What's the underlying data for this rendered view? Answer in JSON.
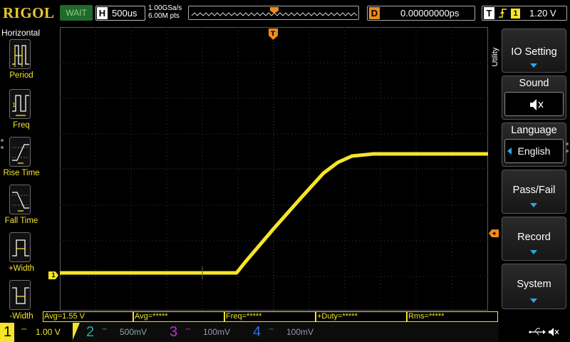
{
  "header": {
    "logo": "RIGOL",
    "run_status": "WAIT",
    "horizontal_letter": "H",
    "timebase": "500us",
    "sample_rate": "1.00GSa/s",
    "memory_depth": "6.00M pts",
    "delay_letter": "D",
    "delay_value": "0.00000000ps",
    "trigger_letter": "T",
    "trigger_edge": "rising-edge-icon",
    "trigger_source": "1",
    "trigger_level": "1.20 V"
  },
  "left_panel": {
    "title": "Horizontal",
    "items": [
      {
        "label": "Period",
        "icon": "period-icon"
      },
      {
        "label": "Freq",
        "icon": "freq-icon"
      },
      {
        "label": "Rise Time",
        "icon": "rise-time-icon"
      },
      {
        "label": "Fall Time",
        "icon": "fall-time-icon"
      },
      {
        "label": "+Width",
        "icon": "positive-width-icon"
      },
      {
        "label": "-Width",
        "icon": "negative-width-icon"
      }
    ]
  },
  "right_menu": {
    "tab": "Utility",
    "items": [
      {
        "label": "IO Setting",
        "kind": "submenu"
      },
      {
        "label": "Sound",
        "value_icon": "speaker-muted-icon"
      },
      {
        "label": "Language",
        "value": "English"
      },
      {
        "label": "Pass/Fail",
        "kind": "submenu"
      },
      {
        "label": "Record",
        "kind": "submenu"
      },
      {
        "label": "System",
        "kind": "submenu"
      }
    ]
  },
  "markers": {
    "channel1": "1",
    "trigger_position": "T"
  },
  "measurements": [
    {
      "text": "Avg=1.55 V"
    },
    {
      "text": "Avg=*****"
    },
    {
      "text": "Freq=*****"
    },
    {
      "text": "+Duty=*****"
    },
    {
      "text": "Rms=*****"
    }
  ],
  "channels": [
    {
      "num": "1",
      "coupling": "DC",
      "scale": "1.00 V",
      "color": "#f5e528",
      "active": true
    },
    {
      "num": "2",
      "coupling": "DC",
      "scale": "500mV",
      "color": "#1fb0a8",
      "active": false
    },
    {
      "num": "3",
      "coupling": "DC",
      "scale": "100mV",
      "color": "#c62ad0",
      "active": false
    },
    {
      "num": "4",
      "coupling": "DC",
      "scale": "100mV",
      "color": "#2a6ee8",
      "active": false
    }
  ],
  "status_icons": [
    "usb-icon",
    "speaker-muted-icon"
  ],
  "colors": {
    "ch1": "#f5e528",
    "trigger": "#f08a1a",
    "menu_arrow": "#2aa8e8",
    "status_wait_bg": "#1f6a2c"
  }
}
